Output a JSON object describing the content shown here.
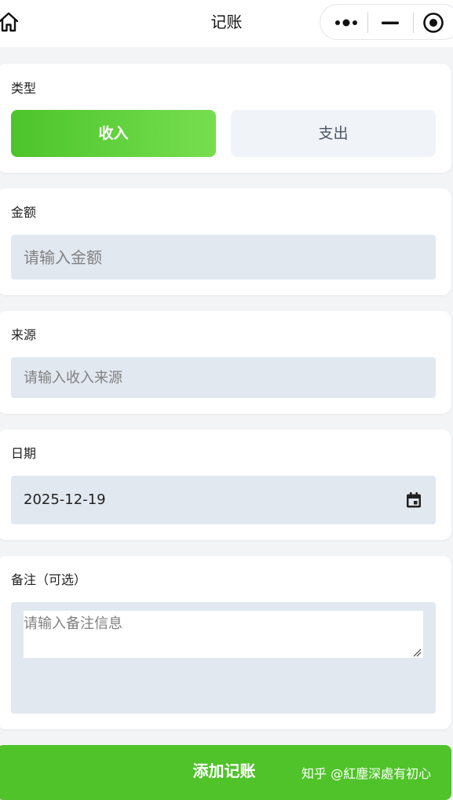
{
  "nav": {
    "title": "记账",
    "home_icon": "home-icon",
    "capsule": {
      "more_icon": "more-dots-icon",
      "minimize_icon": "minimize-icon",
      "close_icon": "target-close-icon"
    }
  },
  "type_section": {
    "label": "类型",
    "options": [
      {
        "label": "收入",
        "selected": true
      },
      {
        "label": "支出",
        "selected": false
      }
    ]
  },
  "amount_section": {
    "label": "金额",
    "placeholder": "请输入金额",
    "value": ""
  },
  "source_section": {
    "label": "来源",
    "placeholder": "请输入收入来源",
    "value": ""
  },
  "date_section": {
    "label": "日期",
    "value": "2025-12-19",
    "icon": "calendar-icon"
  },
  "note_section": {
    "label": "备注（可选）",
    "placeholder": "请输入备注信息",
    "value": ""
  },
  "submit": {
    "label": "添加记账"
  },
  "watermark": {
    "text": "知乎 @紅塵深處有初心"
  },
  "colors": {
    "accent": "#4fc329",
    "field_bg": "#e2e8f0",
    "inactive_btn_bg": "#f0f3f8",
    "page_bg": "#f3f4f6"
  }
}
